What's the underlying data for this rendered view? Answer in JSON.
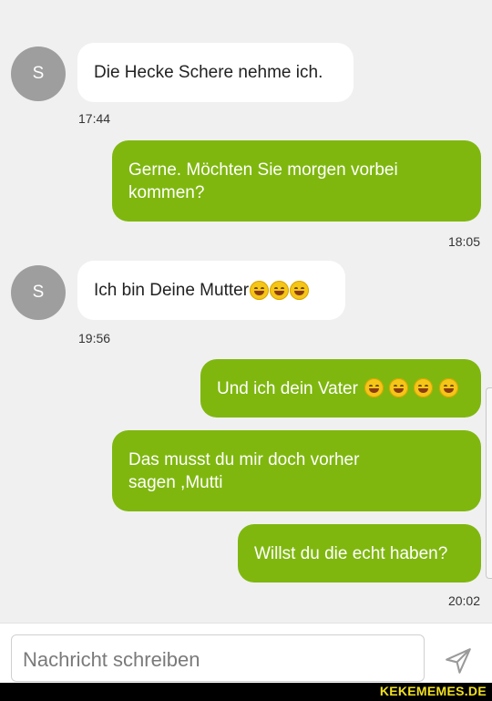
{
  "messages": [
    {
      "sender": "S",
      "text": "Die Hecke Schere nehme ich.",
      "time": "17:44"
    },
    {
      "text_line1": "Gerne. Möchten Sie morgen vorbei",
      "text_line2": "kommen?",
      "time": "18:05"
    },
    {
      "sender": "S",
      "text": "Ich bin Deine Mutter",
      "emojis": [
        "smiling-face-icon",
        "grinning-squinting-face-icon",
        "smiling-face-icon"
      ],
      "time": "19:56"
    },
    {
      "text": "Und ich dein Vater",
      "emojis": [
        "grinning-squinting-face-icon",
        "rolling-laughing-face-icon",
        "rolling-laughing-face-icon",
        "rolling-laughing-face-icon"
      ]
    },
    {
      "text_line1": "Das musst du mir doch vorher",
      "text_line2": "sagen ,Mutti"
    },
    {
      "text": "Willst du die echt haben?",
      "time": "20:02"
    }
  ],
  "composer": {
    "placeholder": "Nachricht schreiben",
    "send_icon": "send-icon"
  },
  "watermark": "KEKEMEMES.DE",
  "colors": {
    "outgoing": "#7fb70f",
    "incoming": "#ffffff",
    "avatar": "#9e9e9e",
    "background": "#f0f0f0"
  }
}
